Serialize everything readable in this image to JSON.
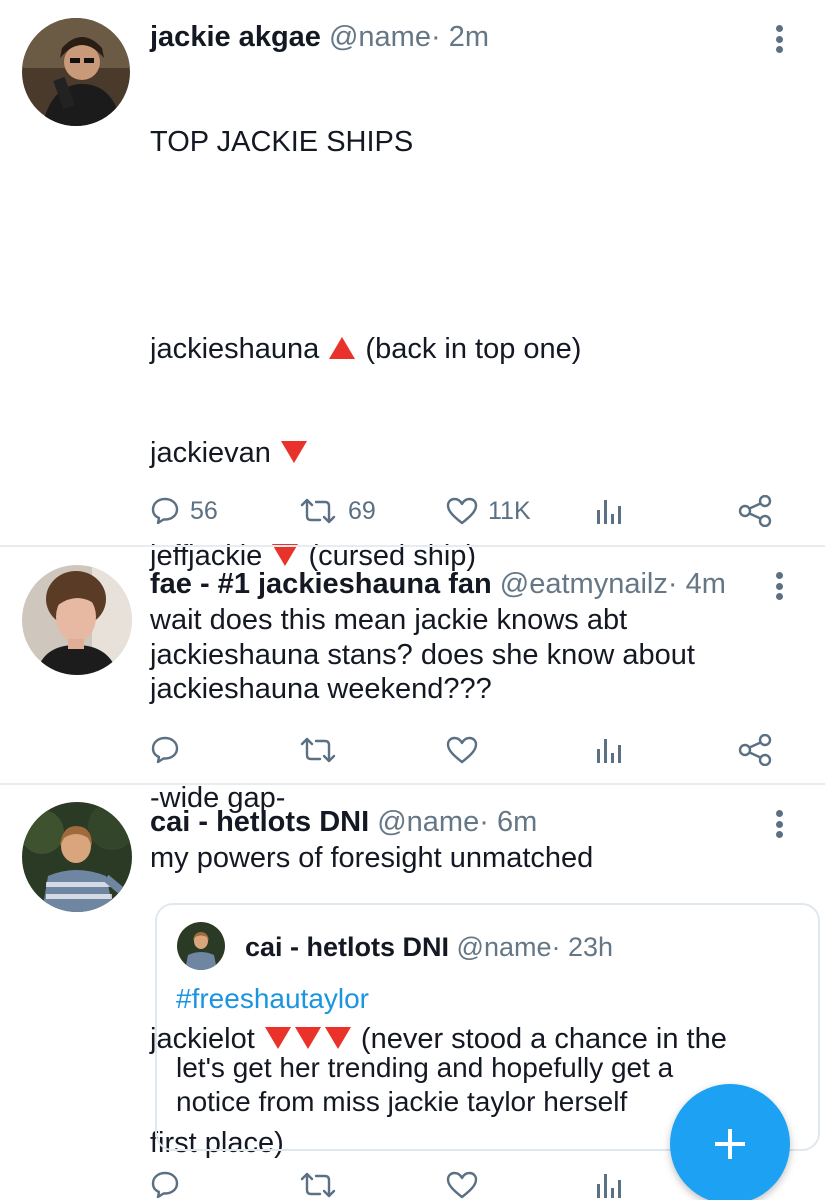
{
  "tweets": [
    {
      "name": "jackie akgae",
      "handle": "@name",
      "dot": "·",
      "time": "2m",
      "lines": {
        "title": "TOP JACKIE SHIPS",
        "l1_name": "jackieshauna",
        "l1_note": "(back in top one)",
        "l2_name": "jackievan",
        "l3_name": "jeffjackie",
        "l3_note": "(cursed ship)",
        "gap": "-wide gap-",
        "l4_name": "jackielot",
        "l4_note": "(never stood a chance in the",
        "l4_note2": "first place)"
      },
      "reply_count": "56",
      "retweet_count": "69",
      "like_count": "11K"
    },
    {
      "name": "fae - #1 jackieshauna fan",
      "handle": "@eatmynailz",
      "dot": "·",
      "time": "4m",
      "text": "wait does this mean jackie knows abt\njackieshauna stans? does she know about\njackieshauna weekend???"
    },
    {
      "name": "cai - hetlots DNI",
      "handle": "@name",
      "dot": "·",
      "time": "6m",
      "text": "my powers of foresight unmatched",
      "quote": {
        "name": "cai - hetlots DNI",
        "handle": "@name",
        "dot": "·",
        "time": "23h",
        "hashtag": "#freeshautaylor",
        "text": "let's get her trending and hopefully get a\nnotice from miss jackie taylor herself"
      }
    }
  ],
  "icons": {
    "reply": "reply-icon",
    "retweet": "retweet-icon",
    "like": "heart-icon",
    "analytics": "analytics-icon",
    "share": "share-icon",
    "menu": "more-vertical-icon",
    "compose": "plus-icon"
  },
  "colors": {
    "accent": "#1da1f2",
    "hashtag": "#1b95e0",
    "muted": "#657786",
    "triangle": "#e8322a"
  }
}
